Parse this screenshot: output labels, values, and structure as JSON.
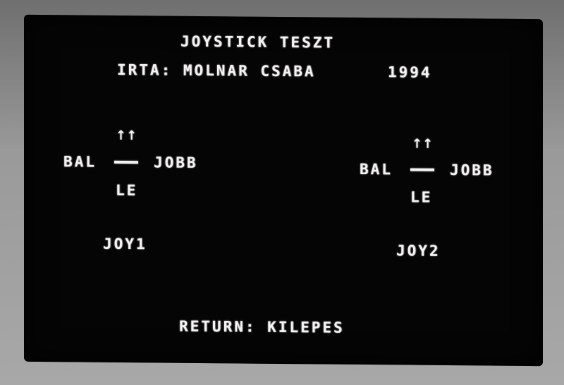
{
  "title": "JOYSTICK TESZT",
  "author_line": "IRTA: MOLNAR CSABA",
  "year": "1994",
  "joy1": {
    "up": "↑↑",
    "left": "BAL",
    "right": "JOBB",
    "down": "LE",
    "label": "JOY1"
  },
  "joy2": {
    "up": "↑↑",
    "left": "BAL",
    "right": "JOBB",
    "down": "LE",
    "label": "JOY2"
  },
  "footer": "RETURN: KILEPES",
  "colors": {
    "screen_bg": "#050505",
    "text": "#f4f4f4",
    "bezel": "#9a9a9a"
  }
}
